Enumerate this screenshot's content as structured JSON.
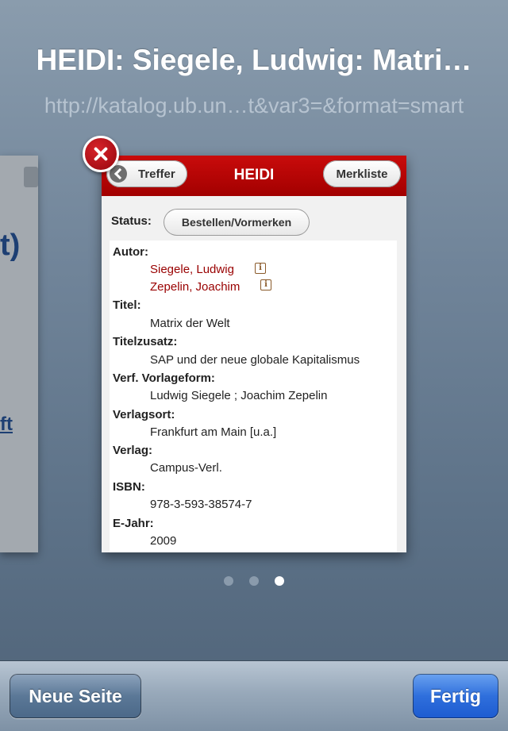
{
  "header": {
    "title": "HEIDI: Siegele, Ludwig: Matri…",
    "url": "http://katalog.ub.un…t&var3=&format=smart"
  },
  "previous_page": {
    "text_fragment_1": "t)",
    "text_fragment_2": "ft"
  },
  "card": {
    "navbar": {
      "title": "HEIDI",
      "back_label": "Treffer",
      "merkliste_label": "Merkliste"
    },
    "status_label": "Status:",
    "order_button_label": "Bestellen/Vormerken",
    "fields": {
      "autor_label": "Autor:",
      "autor_1": "Siegele, Ludwig",
      "autor_2": "Zepelin, Joachim",
      "titel_label": "Titel:",
      "titel_value": "Matrix der Welt",
      "titelzusatz_label": "Titelzusatz:",
      "titelzusatz_value": "SAP und der neue globale Kapitalismus",
      "verf_label": "Verf. Vorlageform:",
      "verf_value": "Ludwig Siegele ; Joachim Zepelin",
      "verlagsort_label": "Verlagsort:",
      "verlagsort_value": "Frankfurt am Main [u.a.]",
      "verlag_label": "Verlag:",
      "verlag_value": "Campus-Verl.",
      "isbn_label": "ISBN:",
      "isbn_value": "978-3-593-38574-7",
      "ejahr_label": "E-Jahr:",
      "ejahr_value": "2009"
    },
    "info_icon_glyph": "i"
  },
  "page_indicator": {
    "total": 3,
    "current": 3
  },
  "toolbar": {
    "new_page_label": "Neue Seite",
    "done_label": "Fertig"
  },
  "colors": {
    "navbar_red": "#b00000",
    "link_red": "#990000",
    "done_blue": "#2f6fdc"
  },
  "icons": {
    "close": "close-icon",
    "back": "chevron-left-icon",
    "info": "info-icon"
  }
}
